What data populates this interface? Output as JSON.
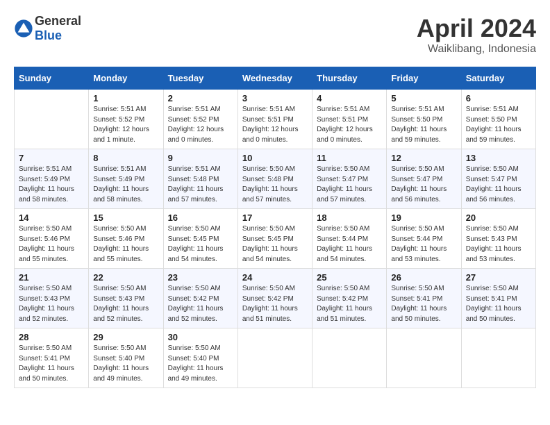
{
  "header": {
    "logo_general": "General",
    "logo_blue": "Blue",
    "month": "April 2024",
    "location": "Waiklibang, Indonesia"
  },
  "days_of_week": [
    "Sunday",
    "Monday",
    "Tuesday",
    "Wednesday",
    "Thursday",
    "Friday",
    "Saturday"
  ],
  "weeks": [
    [
      {
        "day": "",
        "info": ""
      },
      {
        "day": "1",
        "info": "Sunrise: 5:51 AM\nSunset: 5:52 PM\nDaylight: 12 hours\nand 1 minute."
      },
      {
        "day": "2",
        "info": "Sunrise: 5:51 AM\nSunset: 5:52 PM\nDaylight: 12 hours\nand 0 minutes."
      },
      {
        "day": "3",
        "info": "Sunrise: 5:51 AM\nSunset: 5:51 PM\nDaylight: 12 hours\nand 0 minutes."
      },
      {
        "day": "4",
        "info": "Sunrise: 5:51 AM\nSunset: 5:51 PM\nDaylight: 12 hours\nand 0 minutes."
      },
      {
        "day": "5",
        "info": "Sunrise: 5:51 AM\nSunset: 5:50 PM\nDaylight: 11 hours\nand 59 minutes."
      },
      {
        "day": "6",
        "info": "Sunrise: 5:51 AM\nSunset: 5:50 PM\nDaylight: 11 hours\nand 59 minutes."
      }
    ],
    [
      {
        "day": "7",
        "info": "Sunrise: 5:51 AM\nSunset: 5:49 PM\nDaylight: 11 hours\nand 58 minutes."
      },
      {
        "day": "8",
        "info": "Sunrise: 5:51 AM\nSunset: 5:49 PM\nDaylight: 11 hours\nand 58 minutes."
      },
      {
        "day": "9",
        "info": "Sunrise: 5:51 AM\nSunset: 5:48 PM\nDaylight: 11 hours\nand 57 minutes."
      },
      {
        "day": "10",
        "info": "Sunrise: 5:50 AM\nSunset: 5:48 PM\nDaylight: 11 hours\nand 57 minutes."
      },
      {
        "day": "11",
        "info": "Sunrise: 5:50 AM\nSunset: 5:47 PM\nDaylight: 11 hours\nand 57 minutes."
      },
      {
        "day": "12",
        "info": "Sunrise: 5:50 AM\nSunset: 5:47 PM\nDaylight: 11 hours\nand 56 minutes."
      },
      {
        "day": "13",
        "info": "Sunrise: 5:50 AM\nSunset: 5:47 PM\nDaylight: 11 hours\nand 56 minutes."
      }
    ],
    [
      {
        "day": "14",
        "info": "Sunrise: 5:50 AM\nSunset: 5:46 PM\nDaylight: 11 hours\nand 55 minutes."
      },
      {
        "day": "15",
        "info": "Sunrise: 5:50 AM\nSunset: 5:46 PM\nDaylight: 11 hours\nand 55 minutes."
      },
      {
        "day": "16",
        "info": "Sunrise: 5:50 AM\nSunset: 5:45 PM\nDaylight: 11 hours\nand 54 minutes."
      },
      {
        "day": "17",
        "info": "Sunrise: 5:50 AM\nSunset: 5:45 PM\nDaylight: 11 hours\nand 54 minutes."
      },
      {
        "day": "18",
        "info": "Sunrise: 5:50 AM\nSunset: 5:44 PM\nDaylight: 11 hours\nand 54 minutes."
      },
      {
        "day": "19",
        "info": "Sunrise: 5:50 AM\nSunset: 5:44 PM\nDaylight: 11 hours\nand 53 minutes."
      },
      {
        "day": "20",
        "info": "Sunrise: 5:50 AM\nSunset: 5:43 PM\nDaylight: 11 hours\nand 53 minutes."
      }
    ],
    [
      {
        "day": "21",
        "info": "Sunrise: 5:50 AM\nSunset: 5:43 PM\nDaylight: 11 hours\nand 52 minutes."
      },
      {
        "day": "22",
        "info": "Sunrise: 5:50 AM\nSunset: 5:43 PM\nDaylight: 11 hours\nand 52 minutes."
      },
      {
        "day": "23",
        "info": "Sunrise: 5:50 AM\nSunset: 5:42 PM\nDaylight: 11 hours\nand 52 minutes."
      },
      {
        "day": "24",
        "info": "Sunrise: 5:50 AM\nSunset: 5:42 PM\nDaylight: 11 hours\nand 51 minutes."
      },
      {
        "day": "25",
        "info": "Sunrise: 5:50 AM\nSunset: 5:42 PM\nDaylight: 11 hours\nand 51 minutes."
      },
      {
        "day": "26",
        "info": "Sunrise: 5:50 AM\nSunset: 5:41 PM\nDaylight: 11 hours\nand 50 minutes."
      },
      {
        "day": "27",
        "info": "Sunrise: 5:50 AM\nSunset: 5:41 PM\nDaylight: 11 hours\nand 50 minutes."
      }
    ],
    [
      {
        "day": "28",
        "info": "Sunrise: 5:50 AM\nSunset: 5:41 PM\nDaylight: 11 hours\nand 50 minutes."
      },
      {
        "day": "29",
        "info": "Sunrise: 5:50 AM\nSunset: 5:40 PM\nDaylight: 11 hours\nand 49 minutes."
      },
      {
        "day": "30",
        "info": "Sunrise: 5:50 AM\nSunset: 5:40 PM\nDaylight: 11 hours\nand 49 minutes."
      },
      {
        "day": "",
        "info": ""
      },
      {
        "day": "",
        "info": ""
      },
      {
        "day": "",
        "info": ""
      },
      {
        "day": "",
        "info": ""
      }
    ]
  ]
}
